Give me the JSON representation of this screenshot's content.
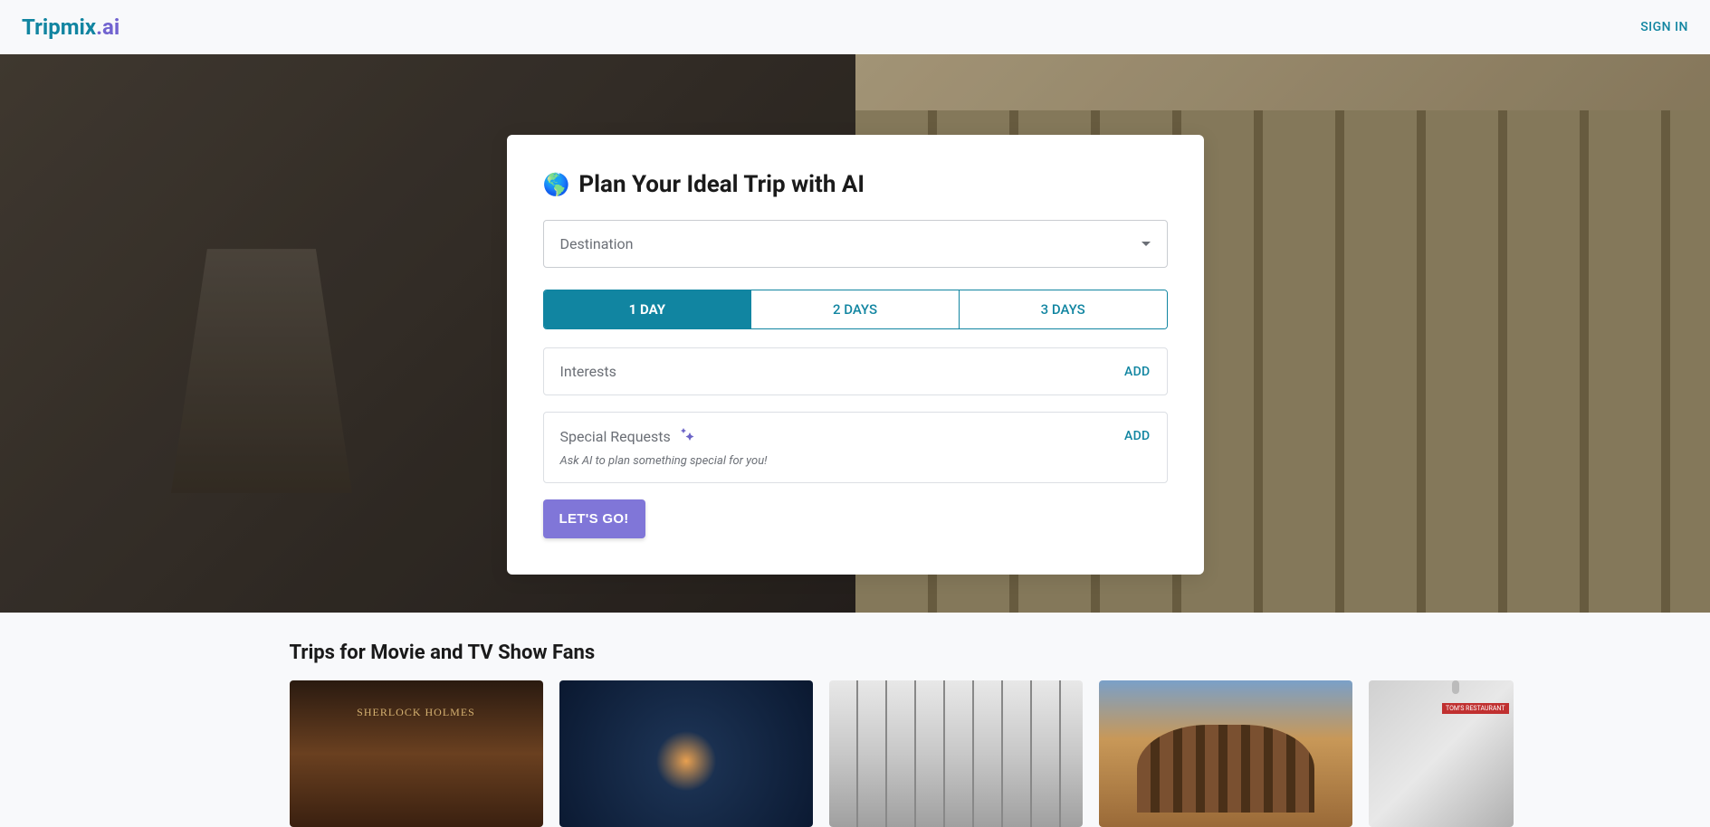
{
  "header": {
    "logo_trip": "Tripmix",
    "logo_ai": ".ai",
    "signin": "SIGN IN"
  },
  "card": {
    "globe": "🌎",
    "title": "Plan Your Ideal Trip with AI",
    "destination_placeholder": "Destination",
    "days": [
      "1 DAY",
      "2 DAYS",
      "3 DAYS"
    ],
    "active_day_index": 0,
    "interests_label": "Interests",
    "interests_add": "ADD",
    "special_label": "Special Requests",
    "special_add": "ADD",
    "special_hint": "Ask AI to plan something special for you!",
    "go_label": "LET'S GO!"
  },
  "section": {
    "title": "Trips for Movie and TV Show Fans"
  }
}
